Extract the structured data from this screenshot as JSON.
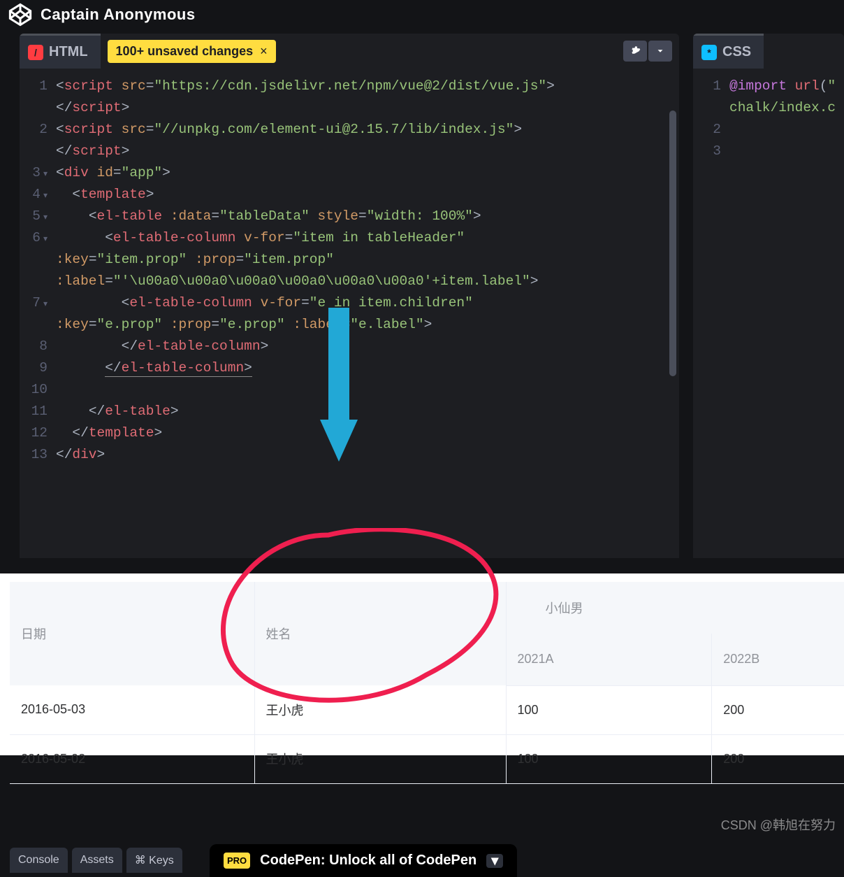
{
  "header": {
    "title": "Captain Anonymous"
  },
  "panels": {
    "html": {
      "label": "HTML",
      "badge_glyph": "/"
    },
    "css": {
      "label": "CSS",
      "badge_glyph": "*"
    }
  },
  "unsaved": {
    "text": "100+ unsaved changes",
    "close_glyph": "×"
  },
  "toolbar_icons": {
    "gear": "gear-icon",
    "caret": "chevron-down-icon"
  },
  "html_code": {
    "line_numbers": [
      "1",
      "",
      "2",
      "",
      "3",
      "4",
      "5",
      "6",
      "",
      "",
      "7",
      "",
      "8",
      "9",
      "10",
      "11",
      "12",
      "13"
    ],
    "lines": [
      "<script src=\"https://cdn.jsdelivr.net/npm/vue@2/dist/vue.js\">",
      "</script>",
      "<script src=\"//unpkg.com/element-ui@2.15.7/lib/index.js\">",
      "</script>",
      "<div id=\"app\">",
      "  <template>",
      "    <el-table :data=\"tableData\" style=\"width: 100%\">",
      "      <el-table-column v-for=\"item in tableHeader\"",
      ":key=\"item.prop\" :prop=\"item.prop\"",
      ":label=\"'\\u00a0\\u00a0\\u00a0\\u00a0\\u00a0\\u00a0'+item.label\">",
      "        <el-table-column v-for=\"e in item.children\"",
      ":key=\"e.prop\" :prop=\"e.prop\" :label=\"e.label\">",
      "        </el-table-column>",
      "      </el-table-column>",
      "",
      "    </el-table>",
      "  </template>",
      "</div>"
    ]
  },
  "css_code": {
    "line_numbers": [
      "1",
      "",
      "2",
      "3"
    ],
    "lines": [
      "@import url(\"",
      "chalk/index.c",
      "",
      ""
    ]
  },
  "preview_table": {
    "headers_rowspan": [
      "日期",
      "姓名"
    ],
    "group_parent": "小仙男",
    "sub_headers": [
      "2021A",
      "2022B"
    ],
    "rows": [
      {
        "date": "2016-05-03",
        "name": "王小虎",
        "c1": "100",
        "c2": "200"
      },
      {
        "date": "2016-05-02",
        "name": "王小虎",
        "c1": "100",
        "c2": "200"
      }
    ]
  },
  "footer": {
    "tabs": [
      "Console",
      "Assets",
      "⌘ Keys"
    ],
    "promo": "CodePen: Unlock all of CodePen",
    "pro_badge": "PRO"
  },
  "watermark": "CSDN @韩旭在努力",
  "annotation_colors": {
    "arrow": "#22a8d6",
    "circle": "#ef1f4f"
  }
}
